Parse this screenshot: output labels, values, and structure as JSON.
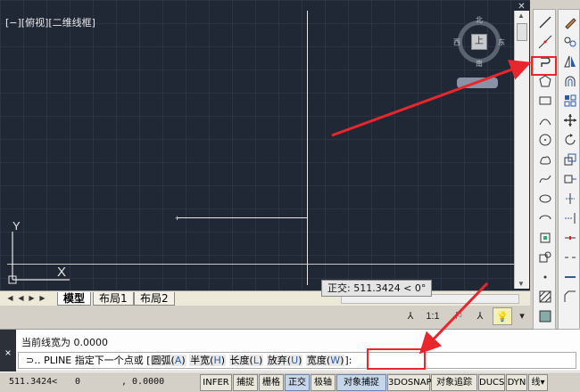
{
  "canvas": {
    "view_label": "[−][俯视][二维线框]",
    "viewcube": {
      "north": "北",
      "south": "南",
      "west": "西",
      "east": "东",
      "face": "上"
    },
    "ucs": {
      "y": "Y",
      "x": "X"
    }
  },
  "tabs": {
    "model": "模型",
    "layout1": "布局1",
    "layout2": "布局2"
  },
  "tooltip": "正交: 511.3424 < 0°",
  "annotation": {
    "scale": "1:1"
  },
  "command": {
    "close": "×",
    "history": "当前线宽为 0.0000",
    "prompt_icon": "⊃‥",
    "prompt": "PLINE 指定下一个点或 [",
    "options": [
      {
        "label": "圆弧",
        "key": "A"
      },
      {
        "label": "半宽",
        "key": "H"
      },
      {
        "label": "长度",
        "key": "L"
      },
      {
        "label": "放弃",
        "key": "U"
      },
      {
        "label": "宽度",
        "key": "W"
      }
    ],
    "prompt_end": "]:"
  },
  "status": {
    "coord_x": "511.3424<",
    "coord_y": "0",
    "coord_z": ", 0.0000",
    "buttons": [
      "INFER",
      "捕捉",
      "栅格",
      "正交",
      "极轴",
      "对象捕捉",
      "3DOSNAP",
      "对象追踪",
      "DUCS",
      "DYN",
      "线▾"
    ],
    "active": [
      "正交",
      "对象捕捉"
    ]
  },
  "toolbar_left": [
    "line-icon",
    "construction-line-icon",
    "polyline-icon",
    "polygon-icon",
    "rectangle-icon",
    "arc-icon",
    "circle-icon",
    "revision-cloud-icon",
    "spline-icon",
    "ellipse-icon",
    "ellipse-arc-icon",
    "insert-block-icon",
    "make-block-icon",
    "point-icon",
    "hatch-icon",
    "gradient-icon"
  ],
  "toolbar_right": [
    "erase-icon",
    "copy-icon",
    "mirror-icon",
    "offset-icon",
    "array-icon",
    "move-icon",
    "rotate-icon",
    "scale-icon",
    "stretch-icon",
    "trim-icon",
    "extend-icon",
    "break-at-point-icon",
    "break-icon",
    "join-icon",
    "chamfer-icon"
  ],
  "colors": {
    "canvas": "#212835",
    "highlight": "#e8262c"
  }
}
